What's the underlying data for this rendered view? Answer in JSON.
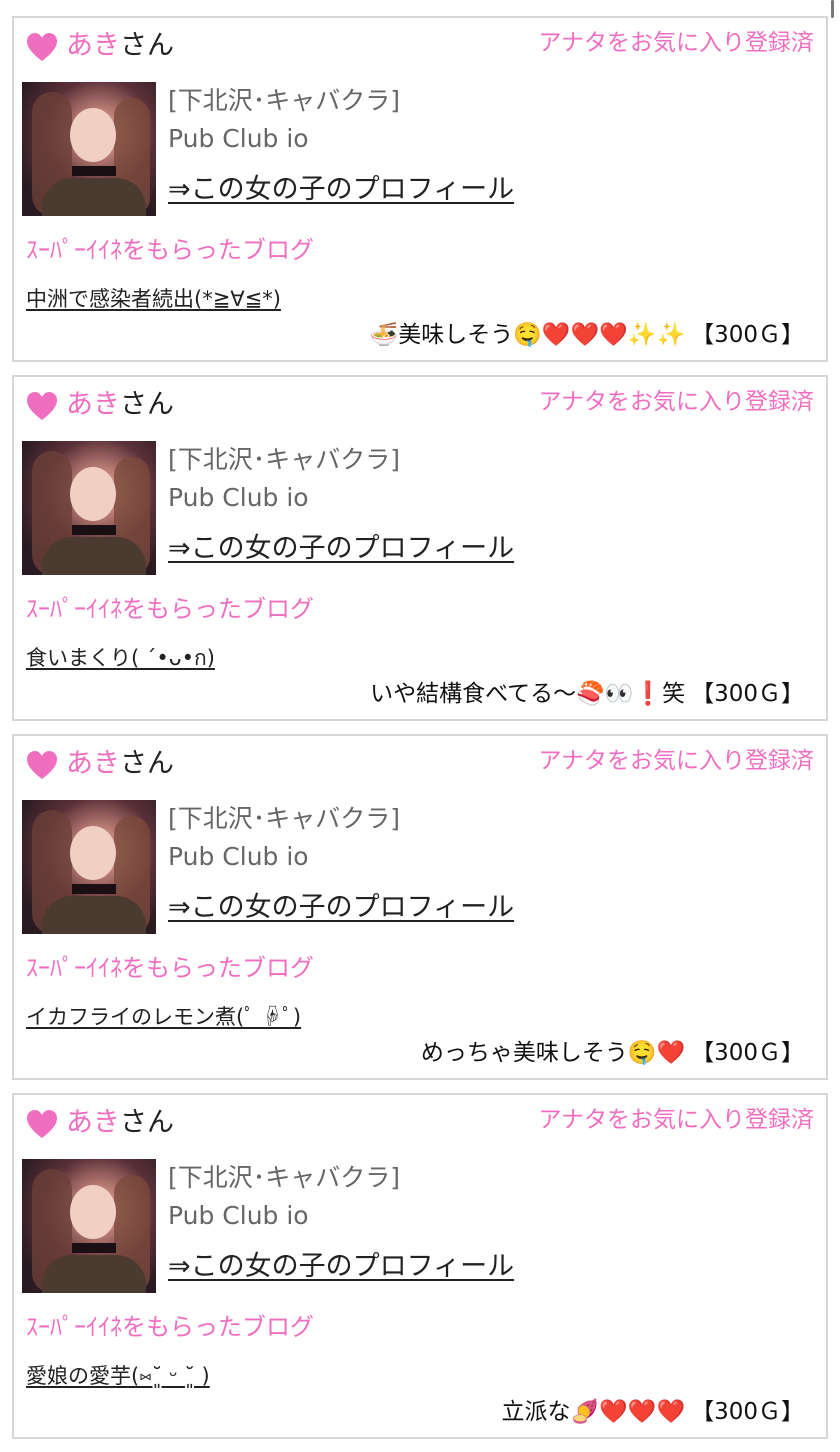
{
  "cards": [
    {
      "name": "あき",
      "suffix": "さん",
      "favorite_status": "アナタをお気に入り登録済",
      "location": "[下北沢･キャバクラ]",
      "club": "Pub Club io",
      "profile_link": "⇒この女の子のプロフィール",
      "super_label": "ｽｰﾊﾟｰｲｲﾈをもらったブログ",
      "blog_title": "中洲で感染者続出(*≧∀≦*)",
      "comment": "🍜美味しそう🤤❤️❤️❤️✨✨",
      "gold": "【300Ｇ】"
    },
    {
      "name": "あき",
      "suffix": "さん",
      "favorite_status": "アナタをお気に入り登録済",
      "location": "[下北沢･キャバクラ]",
      "club": "Pub Club io",
      "profile_link": "⇒この女の子のプロフィール",
      "super_label": "ｽｰﾊﾟｰｲｲﾈをもらったブログ",
      "blog_title": "食いまくり( ´•ᴗ•ก)",
      "comment": "いや結構食べてる〜🍣👀❗️笑",
      "gold": "【300Ｇ】"
    },
    {
      "name": "あき",
      "suffix": "さん",
      "favorite_status": "アナタをお気に入り登録済",
      "location": "[下北沢･キャバクラ]",
      "club": "Pub Club io",
      "profile_link": "⇒この女の子のプロフィール",
      "super_label": "ｽｰﾊﾟｰｲｲﾈをもらったブログ",
      "blog_title": "イカフライのレモン煮(ﾟ ☟ﾟ)",
      "comment": "めっちゃ美味しそう🤤❤️",
      "gold": "【300Ｇ】"
    },
    {
      "name": "あき",
      "suffix": "さん",
      "favorite_status": "アナタをお気に入り登録済",
      "location": "[下北沢･キャバクラ]",
      "club": "Pub Club io",
      "profile_link": "⇒この女の子のプロフィール",
      "super_label": "ｽｰﾊﾟｰｲｲﾈをもらったブログ",
      "blog_title": "愛娘の愛芋(⑅˘͈ ᵕ ˘͈ )",
      "comment": "立派な🍠❤️❤️❤️",
      "gold": "【300Ｇ】"
    }
  ],
  "colors": {
    "accent_pink": "#f06ec0",
    "border": "#d6d6d6"
  },
  "icons": {
    "heart": "heart-icon"
  }
}
